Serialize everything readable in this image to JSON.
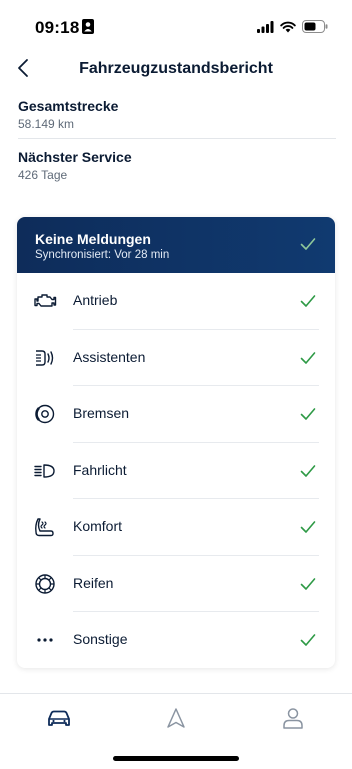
{
  "status_bar": {
    "time": "09:18"
  },
  "header": {
    "title": "Fahrzeugzustandsbericht"
  },
  "info": [
    {
      "label": "Gesamtstrecke",
      "value": "58.149 km"
    },
    {
      "label": "Nächster Service",
      "value": "426 Tage"
    }
  ],
  "card": {
    "title": "Keine Meldungen",
    "subtitle": "Synchronisiert: Vor 28 min",
    "items": [
      {
        "label": "Antrieb",
        "icon": "engine-icon"
      },
      {
        "label": "Assistenten",
        "icon": "assist-icon"
      },
      {
        "label": "Bremsen",
        "icon": "brake-icon"
      },
      {
        "label": "Fahrlicht",
        "icon": "headlight-icon"
      },
      {
        "label": "Komfort",
        "icon": "seat-icon"
      },
      {
        "label": "Reifen",
        "icon": "tire-icon"
      },
      {
        "label": "Sonstige",
        "icon": "more-icon"
      }
    ]
  },
  "tabbar": {
    "tabs": [
      "car-icon",
      "navigation-icon",
      "profile-icon"
    ]
  },
  "colors": {
    "header_bg": "#0e2c5a",
    "check": "#2e9a46",
    "text": "#0b1b33",
    "muted": "#5f6a78"
  }
}
